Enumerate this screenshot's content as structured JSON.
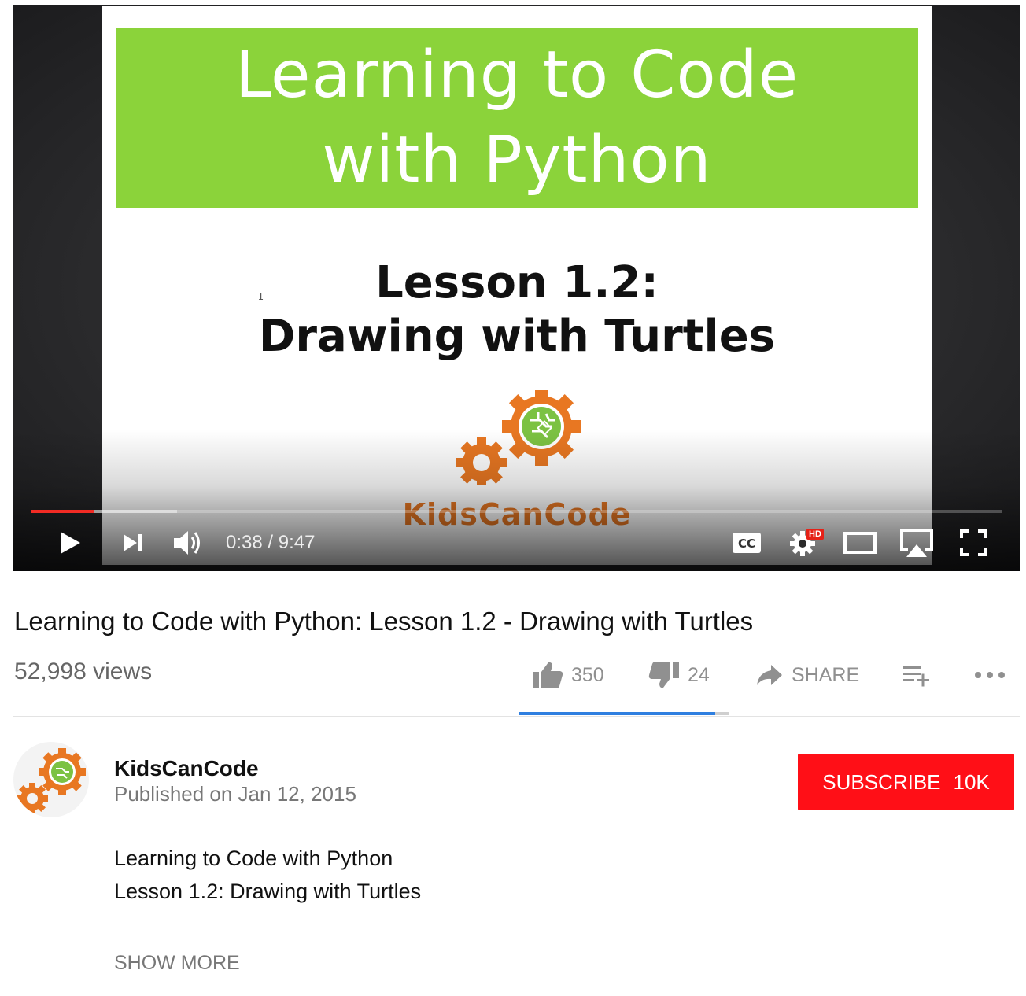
{
  "player": {
    "slide": {
      "banner_text": "Learning to Code\nwith Python",
      "lesson_text": "Lesson 1.2:\nDrawing with Turtles",
      "logo_text": "KidsCanCode"
    },
    "progress": {
      "played_fraction": 0.065,
      "buffered_fraction": 0.15
    },
    "time_display": "0:38 / 9:47",
    "hd_badge": "HD",
    "colors": {
      "progress": "#f12b24",
      "banner": "#8bd33a"
    },
    "icons": [
      "play-icon",
      "next-icon",
      "volume-icon",
      "captions-icon",
      "settings-icon",
      "theater-mode-icon",
      "airplay-icon",
      "fullscreen-icon"
    ]
  },
  "video": {
    "title": "Learning to Code with Python: Lesson 1.2 - Drawing with Turtles",
    "views": "52,998 views",
    "likes": "350",
    "dislikes": "24",
    "share_label": "SHARE",
    "like_fraction": 0.936
  },
  "channel": {
    "name": "KidsCanCode",
    "published": "Published on Jan 12, 2015",
    "subscribe_label": "SUBSCRIBE",
    "subscriber_count": "10K",
    "subscribe_color": "#ff0f17"
  },
  "description": {
    "line1": "Learning to Code with Python",
    "line2": "Lesson 1.2: Drawing with Turtles",
    "show_more": "SHOW MORE"
  }
}
